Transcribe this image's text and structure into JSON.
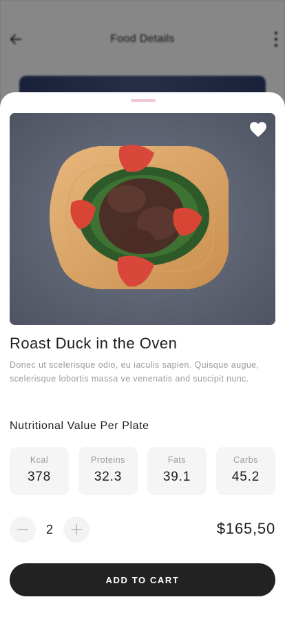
{
  "header": {
    "title": "Food Details"
  },
  "product": {
    "name": "Roast Duck in the Oven",
    "description": "Donec ut scelerisque odio, eu iaculis sapien. Quisque augue, scelerisque lobortis massa ve venenatis and suscipit nunc.",
    "image_icon": "food-photo",
    "favorite_icon": "heart-icon"
  },
  "nutrition": {
    "heading": "Nutritional Value Per Plate",
    "items": [
      {
        "label": "Kcal",
        "value": "378"
      },
      {
        "label": "Proteins",
        "value": "32.3"
      },
      {
        "label": "Fats",
        "value": "39.1"
      },
      {
        "label": "Carbs",
        "value": "45.2"
      }
    ]
  },
  "order": {
    "quantity": "2",
    "price": "$165,50",
    "minus_icon": "minus-icon",
    "plus_icon": "plus-icon",
    "cta_label": "ADD TO CART"
  },
  "colors": {
    "primary": "#222222",
    "handle": "#f3c9d3",
    "card_bg": "#f5f5f6",
    "muted_text": "#9a9a9a"
  }
}
